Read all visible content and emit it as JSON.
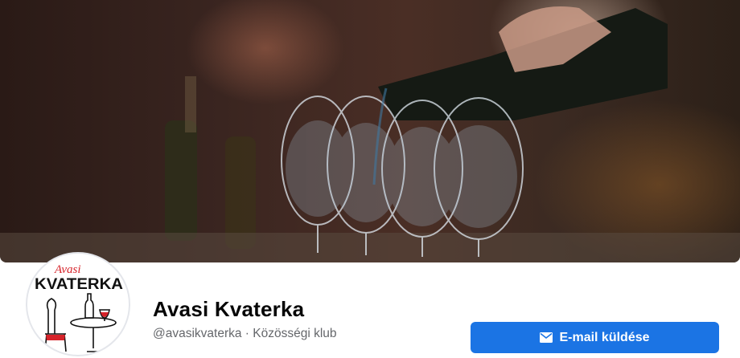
{
  "page": {
    "name": "Avasi Kvaterka",
    "handle": "@avasikvaterka",
    "separator": " · ",
    "category": "Közösségi klub"
  },
  "avatar": {
    "logo_script": "Avasi",
    "logo_word": "KVATERKA"
  },
  "actions": {
    "email_label": "E-mail küldése",
    "email_icon": "envelope-icon"
  },
  "colors": {
    "accent": "#1b74e4",
    "title": "#050505",
    "subtitle": "#65676b",
    "logo_red": "#d6232a"
  }
}
